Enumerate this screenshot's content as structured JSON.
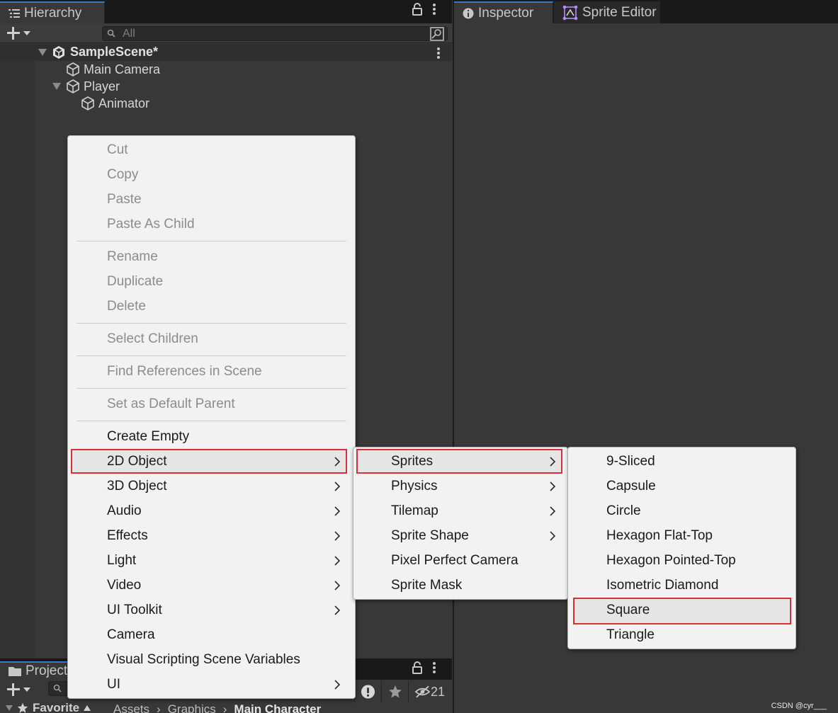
{
  "hierarchy": {
    "tab_label": "Hierarchy",
    "search_placeholder": "All",
    "scene_name": "SampleScene*",
    "items": [
      {
        "label": "Main Camera"
      },
      {
        "label": "Player"
      },
      {
        "label": "Animator"
      }
    ]
  },
  "inspector": {
    "tab_label": "Inspector",
    "sprite_editor_label": "Sprite Editor"
  },
  "project": {
    "tab_label": "Project",
    "hidden_count": "21",
    "favorite_label": "Favorite",
    "breadcrumbs": [
      "Assets",
      "Graphics",
      "Main Character"
    ]
  },
  "context_menu": {
    "items": [
      {
        "label": "Cut",
        "disabled": true
      },
      {
        "label": "Copy",
        "disabled": true
      },
      {
        "label": "Paste",
        "disabled": true
      },
      {
        "label": "Paste As Child",
        "disabled": true
      },
      {
        "label": "Rename",
        "disabled": true
      },
      {
        "label": "Duplicate",
        "disabled": true
      },
      {
        "label": "Delete",
        "disabled": true
      },
      {
        "label": "Select Children",
        "disabled": true
      },
      {
        "label": "Find References in Scene",
        "disabled": true
      },
      {
        "label": "Set as Default Parent",
        "disabled": true
      },
      {
        "label": "Create Empty",
        "disabled": false
      },
      {
        "label": "2D Object",
        "disabled": false,
        "submenu": true,
        "highlighted": true
      },
      {
        "label": "3D Object",
        "disabled": false,
        "submenu": true
      },
      {
        "label": "Audio",
        "disabled": false,
        "submenu": true
      },
      {
        "label": "Effects",
        "disabled": false,
        "submenu": true
      },
      {
        "label": "Light",
        "disabled": false,
        "submenu": true
      },
      {
        "label": "Video",
        "disabled": false,
        "submenu": true
      },
      {
        "label": "UI Toolkit",
        "disabled": false,
        "submenu": true
      },
      {
        "label": "Camera",
        "disabled": false
      },
      {
        "label": "Visual Scripting Scene Variables",
        "disabled": false
      },
      {
        "label": "UI",
        "disabled": false,
        "submenu": true
      }
    ]
  },
  "submenu_2d": {
    "items": [
      {
        "label": "Sprites",
        "submenu": true,
        "highlighted": true
      },
      {
        "label": "Physics",
        "submenu": true
      },
      {
        "label": "Tilemap",
        "submenu": true
      },
      {
        "label": "Sprite Shape",
        "submenu": true
      },
      {
        "label": "Pixel Perfect Camera"
      },
      {
        "label": "Sprite Mask"
      }
    ]
  },
  "submenu_sprites": {
    "items": [
      {
        "label": "9-Sliced"
      },
      {
        "label": "Capsule"
      },
      {
        "label": "Circle"
      },
      {
        "label": "Hexagon Flat-Top"
      },
      {
        "label": "Hexagon Pointed-Top"
      },
      {
        "label": "Isometric Diamond"
      },
      {
        "label": "Square",
        "highlighted": true
      },
      {
        "label": "Triangle"
      }
    ]
  },
  "watermark": "CSDN @cyr___",
  "colors": {
    "highlight_border": "#d6313b",
    "menu_background": "#f2f2f2",
    "editor_background": "#383838"
  }
}
